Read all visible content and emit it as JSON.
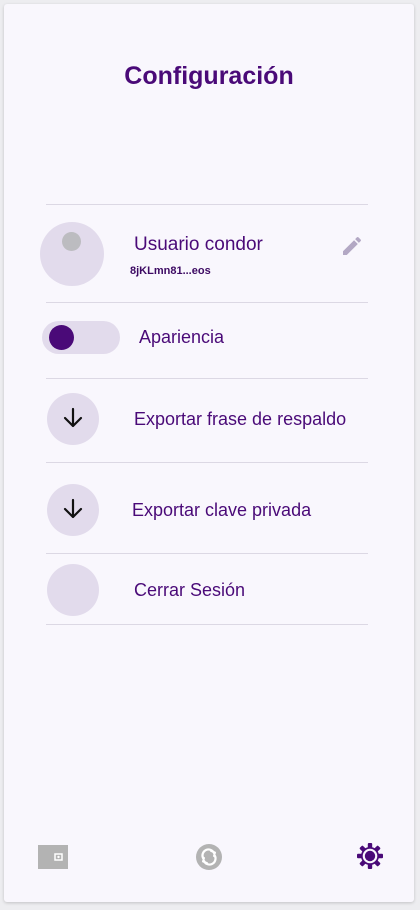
{
  "header": {
    "title": "Configuración"
  },
  "profile": {
    "name": "Usuario condor",
    "address": "8jKLmn81...eos",
    "edit_icon": "pencil-icon"
  },
  "menu": {
    "appearance_label": "Apariencia",
    "appearance_toggle_on": true,
    "export_phrase_label": "Exportar frase de respaldo",
    "export_key_label": "Exportar clave privada",
    "logout_label": "Cerrar Sesión"
  },
  "bottom_nav": {
    "items": [
      "wallet-icon",
      "swap-icon",
      "settings-icon"
    ],
    "active": "settings-icon"
  },
  "colors": {
    "accent": "#4a0a78",
    "surface": "#f9f7fd",
    "circle": "#e2dbec",
    "inactive_icon": "#b3b3b3"
  }
}
